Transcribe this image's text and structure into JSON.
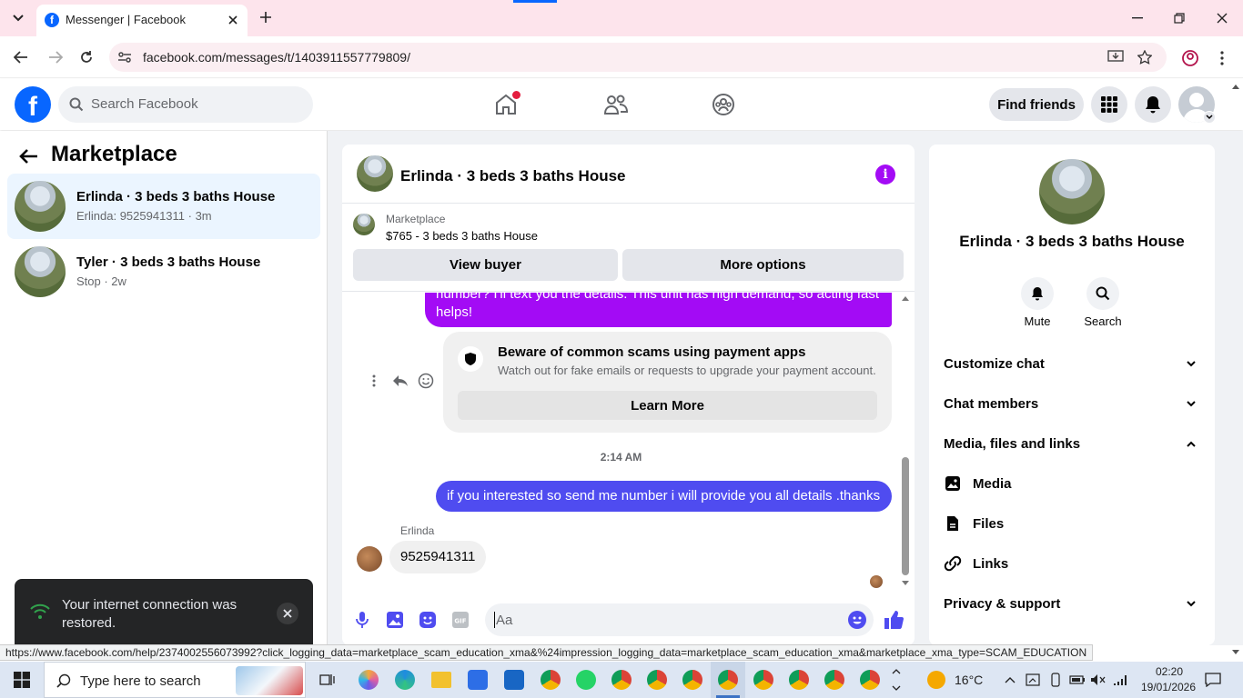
{
  "browser": {
    "tab_title": "Messenger | Facebook",
    "url": "facebook.com/messages/t/1403911557779809/"
  },
  "fb_header": {
    "search_placeholder": "Search Facebook",
    "find_friends": "Find friends"
  },
  "sidebar": {
    "title": "Marketplace",
    "conversations": [
      {
        "title": "Erlinda · 3 beds 3 baths House",
        "subtitle": "Erlinda: 9525941311 · 3m"
      },
      {
        "title": "Tyler · 3 beds 3 baths House",
        "subtitle": "Stop · 2w"
      }
    ]
  },
  "toast": {
    "message": "Your internet connection was restored."
  },
  "chat": {
    "title": "Erlinda · 3 beds 3 baths House",
    "marketplace_label": "Marketplace",
    "listing": "$765 - 3 beds 3 baths House",
    "view_buyer": "View buyer",
    "more_options": "More options",
    "msg_partial": "number? I'll text you the details. This unit has high demand, so acting fast helps!",
    "scam_title": "Beware of common scams using payment apps",
    "scam_body": "Watch out for fake emails or requests to upgrade your payment account.",
    "learn_more": "Learn More",
    "timestamp": "2:14 AM",
    "msg_sent": "if you interested so send me number i will provide you all details .thanks",
    "sender_name": "Erlinda",
    "msg_received": "9525941311",
    "composer_placeholder": "Aa"
  },
  "info_panel": {
    "title": "Erlinda · 3 beds 3 baths House",
    "mute": "Mute",
    "search": "Search",
    "customize_chat": "Customize chat",
    "chat_members": "Chat members",
    "media_files_links": "Media, files and links",
    "media": "Media",
    "files": "Files",
    "links": "Links",
    "privacy_support": "Privacy & support"
  },
  "status_url": "https://www.facebook.com/help/2374002556073992?click_logging_data=marketplace_scam_education_xma&%24impression_logging_data=marketplace_scam_education_xma&marketplace_xma_type=SCAM_EDUCATION",
  "taskbar": {
    "search_placeholder": "Type here to search",
    "weather": "16°C",
    "time": "02:20",
    "date": "19/01/2026"
  },
  "colors": {
    "messenger_purple": "#a30bf5",
    "messenger_blue": "#4f4cf0",
    "fb_blue": "#0866ff",
    "tab_strip": "#fde4ec",
    "taskbar": "#dde6f3"
  }
}
